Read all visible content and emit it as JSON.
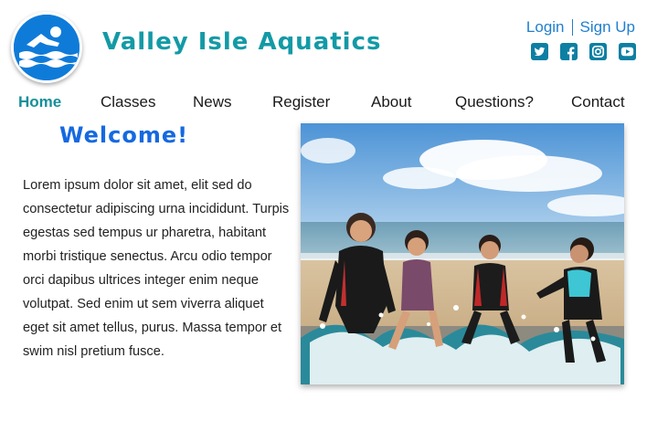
{
  "header": {
    "site_title": "Valley Isle Aquatics",
    "logo_icon": "swimmer-logo-icon",
    "auth": {
      "login_label": "Login",
      "signup_label": "Sign Up"
    },
    "social_icons": [
      "twitter-icon",
      "facebook-icon",
      "instagram-icon",
      "youtube-icon"
    ]
  },
  "nav": {
    "items": [
      {
        "label": "Home",
        "active": true
      },
      {
        "label": "Classes",
        "active": false
      },
      {
        "label": "News",
        "active": false
      },
      {
        "label": "Register",
        "active": false
      },
      {
        "label": "About",
        "active": false
      },
      {
        "label": "Questions?",
        "active": false
      },
      {
        "label": "Contact",
        "active": false
      }
    ]
  },
  "main": {
    "heading": "Welcome!",
    "body": "Lorem ipsum dolor sit amet, elit sed do consectetur adipiscing urna incididunt. Turpis egestas sed tempus ur pharetra, habitant morbi tristique senectus. Arcu odio tempor orci dapibus ultrices integer enim neque volutpat. Sed enim ut sem viverra aliquet eget sit amet tellus, purus. Massa tempor et swim nisl pretium fusce."
  },
  "colors": {
    "brand_teal": "#139aa6",
    "link_blue": "#1f7fcf",
    "heading_blue": "#1569e0",
    "logo_blue": "#0f7bd9"
  }
}
